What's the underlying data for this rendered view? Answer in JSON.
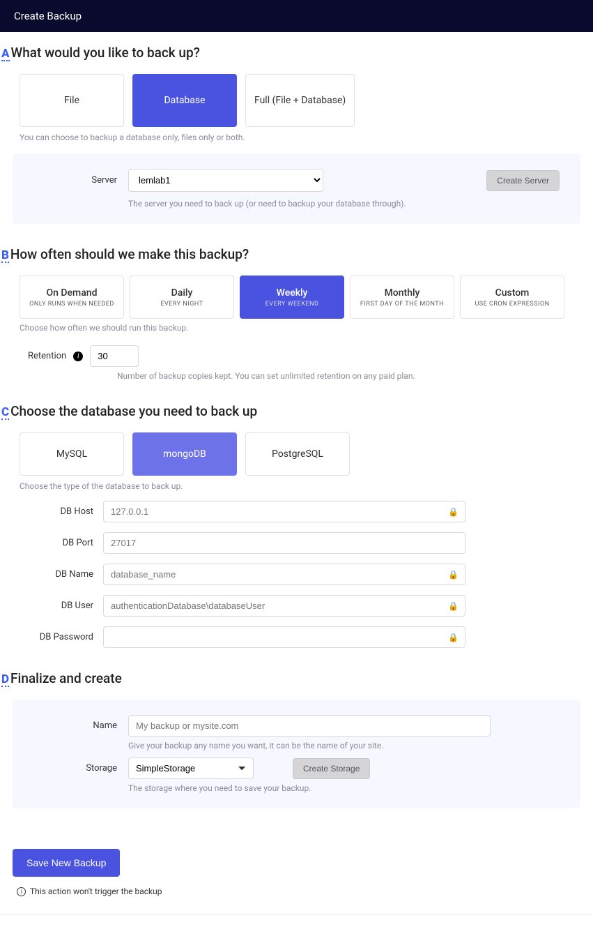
{
  "header": {
    "title": "Create Backup"
  },
  "sectionA": {
    "bullet": "A",
    "title": "What would you like to back up?",
    "options": [
      "File",
      "Database",
      "Full (File + Database)"
    ],
    "help": "You can choose to backup a database only, files only or both.",
    "server_label": "Server",
    "server_value": "lemlab1",
    "create_server_label": "Create Server",
    "server_help": "The server you need to back up (or need to backup your database through)."
  },
  "sectionB": {
    "bullet": "B",
    "title": "How often should we make this backup?",
    "freq": [
      {
        "title": "On Demand",
        "sub": "ONLY RUNS WHEN NEEDED"
      },
      {
        "title": "Daily",
        "sub": "EVERY NIGHT"
      },
      {
        "title": "Weekly",
        "sub": "EVERY WEEKEND"
      },
      {
        "title": "Monthly",
        "sub": "FIRST DAY OF THE MONTH"
      },
      {
        "title": "Custom",
        "sub": "USE CRON EXPRESSION"
      }
    ],
    "help": "Choose how often we should run this backup.",
    "retention_label": "Retention",
    "retention_value": "30",
    "retention_help": "Number of backup copies kept. You can set unlimited retention on any paid plan."
  },
  "sectionC": {
    "bullet": "C",
    "title": "Choose the database you need to back up",
    "dbs": [
      "MySQL",
      "mongoDB",
      "PostgreSQL"
    ],
    "help": "Choose the type of the database to back up.",
    "fields": {
      "host": {
        "label": "DB Host",
        "placeholder": "127.0.0.1"
      },
      "port": {
        "label": "DB Port",
        "placeholder": "27017"
      },
      "name": {
        "label": "DB Name",
        "placeholder": "database_name"
      },
      "user": {
        "label": "DB User",
        "placeholder": "authenticationDatabase\\databaseUser"
      },
      "pass": {
        "label": "DB Password",
        "placeholder": ""
      }
    }
  },
  "sectionD": {
    "bullet": "D",
    "title": "Finalize and create",
    "name_label": "Name",
    "name_placeholder": "My backup or mysite.com",
    "name_help": "Give your backup any name you want, it can be the name of your site.",
    "storage_label": "Storage",
    "storage_value": "SimpleStorage",
    "create_storage_label": "Create Storage",
    "storage_help": "The storage where you need to save your backup."
  },
  "submit": {
    "label": "Save New Backup",
    "note": "This action won't trigger the backup"
  }
}
